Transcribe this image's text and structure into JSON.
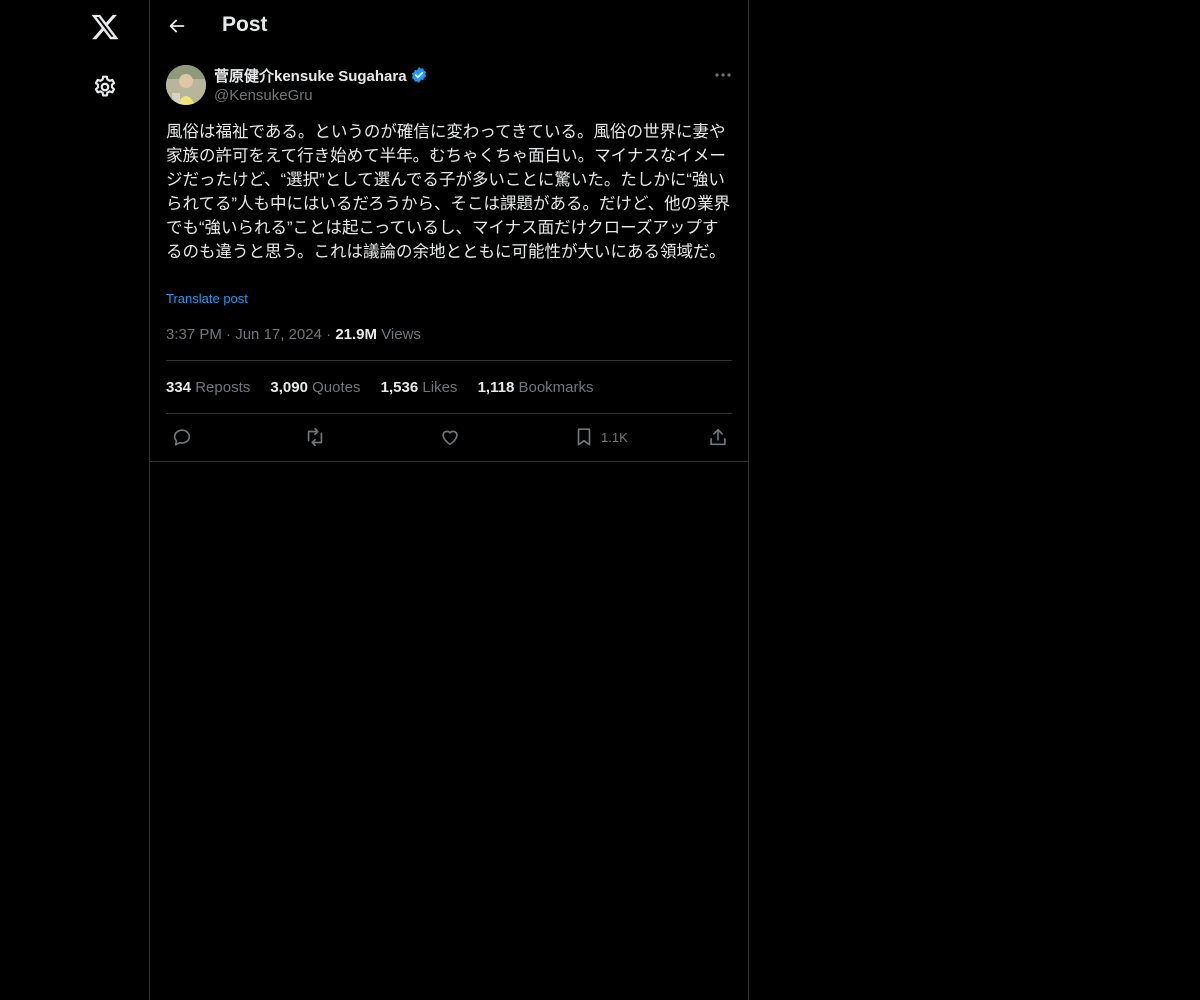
{
  "colors": {
    "background": "#000000",
    "text": "#e7e9ea",
    "muted": "#71767b",
    "link": "#1d9bf0",
    "border": "#2f3336",
    "verified": "#1d9bf0"
  },
  "sidebar": {
    "logo_icon": "x-logo-icon",
    "settings_icon": "gear-icon"
  },
  "header": {
    "back_icon": "arrow-left-icon",
    "title": "Post"
  },
  "author": {
    "display_name": "菅原健介kensuke Sugahara",
    "handle": "@KensukeGru",
    "verified_icon": "verified-badge-icon"
  },
  "post": {
    "text": "風俗は福祉である。というのが確信に変わってきている。風俗の世界に妻や家族の許可をえて行き始めて半年。むちゃくちゃ面白い。マイナスなイメージだったけど、“選択”として選んでる子が多いことに驚いた。たしかに“強いられてる”人も中にはいるだろうから、そこは課題がある。だけど、他の業界でも“強いられる”ことは起こっているし、マイナス面だけクローズアップするのも違うと思う。これは議論の余地とともに可能性が大いにある領域だ。",
    "translate_label": "Translate post",
    "time": "3:37 PM",
    "date": "Jun 17, 2024",
    "views_count": "21.9M",
    "views_label": "Views"
  },
  "stats": [
    {
      "count": "334",
      "label": "Reposts"
    },
    {
      "count": "3,090",
      "label": "Quotes"
    },
    {
      "count": "1,536",
      "label": "Likes"
    },
    {
      "count": "1,118",
      "label": "Bookmarks"
    }
  ],
  "actions": {
    "reply_icon": "reply-icon",
    "repost_icon": "repost-icon",
    "like_icon": "heart-icon",
    "bookmark_icon": "bookmark-icon",
    "bookmark_count": "1.1K",
    "share_icon": "share-icon"
  }
}
